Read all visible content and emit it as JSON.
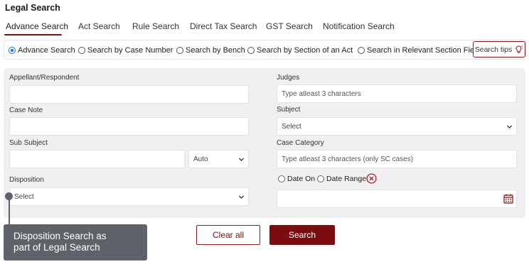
{
  "page_title": "Legal Search",
  "tabs": [
    {
      "label": "Advance Search",
      "active": true
    },
    {
      "label": "Act Search"
    },
    {
      "label": "Rule Search"
    },
    {
      "label": "Direct Tax Search"
    },
    {
      "label": "GST Search"
    },
    {
      "label": "Notification Search"
    }
  ],
  "search_modes": [
    {
      "label": "Advance Search",
      "checked": true
    },
    {
      "label": "Search by Case Number"
    },
    {
      "label": "Search by Bench"
    },
    {
      "label": "Search by Section of an Act"
    },
    {
      "label": "Search in Relevant Section Field"
    }
  ],
  "search_tips_label": "Search tips",
  "form": {
    "appellant_label": "Appellant/Respondent",
    "appellant_value": "",
    "case_note_label": "Case Note",
    "case_note_value": "",
    "sub_subject_label": "Sub Subject",
    "sub_subject_value": "",
    "sub_subject_mode": "Auto",
    "disposition_label": "Disposition",
    "disposition_value": "Select",
    "judges_label": "Judges",
    "judges_placeholder": "Type atleast 3 characters",
    "subject_label": "Subject",
    "subject_value": "Select",
    "case_category_label": "Case Category",
    "case_category_placeholder": "Type atleast 3 characters (only SC cases)",
    "date_on_label": "Date On",
    "date_range_label": "Date Range",
    "date_value": ""
  },
  "buttons": {
    "clear_label": "Clear all",
    "search_label": "Search"
  },
  "callout": {
    "line1": "Disposition Search as",
    "line2": "part of Legal Search"
  },
  "colors": {
    "accent": "#7b0c10",
    "radio_checked": "#1a6fd6",
    "panel_bg": "#f0f0f0",
    "callout_bg": "#5f6369"
  }
}
